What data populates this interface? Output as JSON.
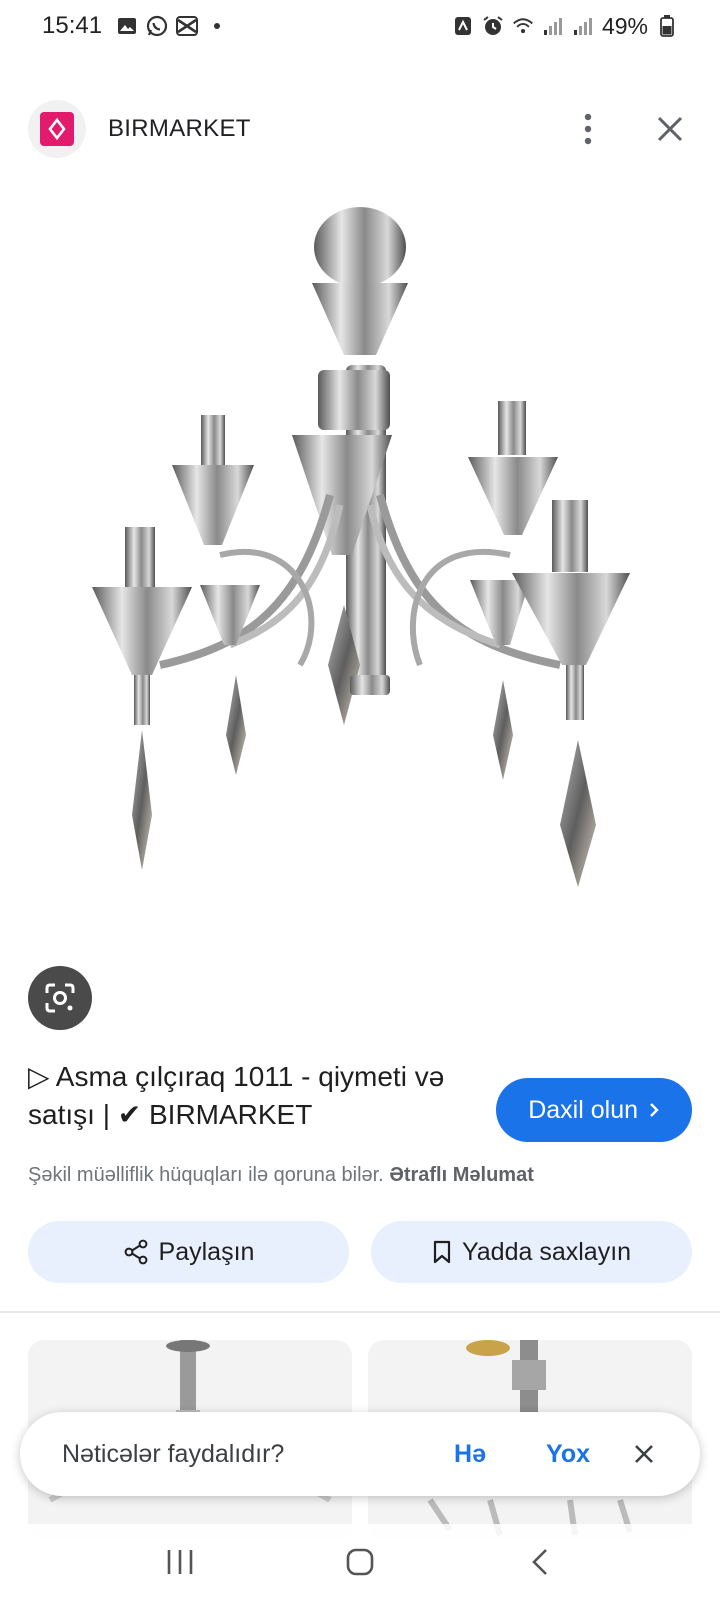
{
  "status_bar": {
    "time": "15:41",
    "battery": "49%",
    "icons_left": [
      "gallery-icon",
      "whatsapp-icon",
      "capcut-icon",
      "dot-icon"
    ],
    "icons_right": [
      "nfc-icon",
      "alarm-icon",
      "wifi-icon",
      "signal-icon",
      "signal-icon",
      "battery-icon"
    ]
  },
  "source": {
    "name": "BIRMARKET",
    "brand_color": "#e31b6d"
  },
  "result": {
    "title": "▷ Asma çılçıraq 1011 - qiymeti və satışı | ✔ BIRMARKET",
    "visit_label": "Daxil olun",
    "copyright_text": "Şəkil müəlliflik hüquqları ilə qoruna bilər.",
    "more_info_label": "Ətraflı Məlumat"
  },
  "actions": {
    "share_label": "Paylaşın",
    "save_label": "Yadda saxlayın"
  },
  "feedback": {
    "question": "Nəticələr faydalıdır?",
    "yes_label": "Hə",
    "no_label": "Yox"
  },
  "colors": {
    "accent": "#1a73e8",
    "chip_bg": "#e8f0fe"
  }
}
